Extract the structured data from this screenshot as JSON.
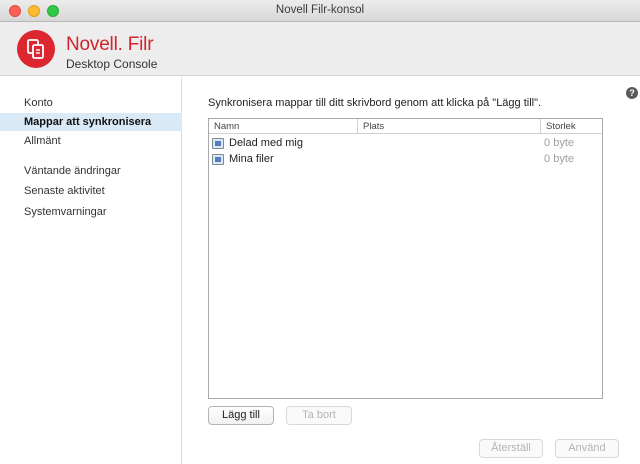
{
  "window": {
    "title": "Novell Filr-konsol"
  },
  "brand": {
    "name": "Novell. Filr",
    "subtitle": "Desktop Console",
    "logo_icon": "filr-logo-icon",
    "accent": "#dc2630"
  },
  "help": {
    "label": "?"
  },
  "sidebar": {
    "items": [
      {
        "label": "Konto",
        "active": false
      },
      {
        "label": "Mappar att synkronisera",
        "active": true
      },
      {
        "label": "Allmänt",
        "active": false
      },
      {
        "label": "Väntande ändringar",
        "active": false
      },
      {
        "label": "Senaste aktivitet",
        "active": false
      },
      {
        "label": "Systemvarningar",
        "active": false
      }
    ]
  },
  "main": {
    "instruction": "Synkronisera mappar till ditt skrivbord genom att klicka på \"Lägg till\".",
    "table": {
      "columns": [
        "Namn",
        "Plats",
        "Storlek"
      ],
      "rows": [
        {
          "name": "Delad med mig",
          "location": "",
          "size": "0 byte",
          "icon": "shared-folder-icon"
        },
        {
          "name": "Mina filer",
          "location": "",
          "size": "0 byte",
          "icon": "my-files-folder-icon"
        }
      ]
    },
    "buttons": {
      "add": "Lägg till",
      "remove": "Ta bort"
    }
  },
  "footer": {
    "reset": "Återställ",
    "apply": "Använd"
  }
}
